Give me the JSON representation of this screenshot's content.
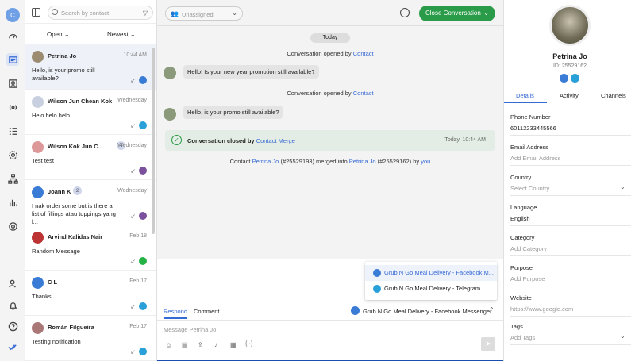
{
  "rail": {
    "avatar_initial": "C",
    "icons": [
      "dashboard-icon",
      "inbox-icon",
      "contacts-icon",
      "broadcast-icon",
      "checklist-icon",
      "settings-cog-icon",
      "workflow-icon",
      "reports-icon",
      "settings-icon",
      "add-user-icon",
      "bell-icon",
      "help-icon",
      "checkmarks-icon"
    ]
  },
  "list": {
    "search_placeholder": "Search by contact",
    "filter_open": "Open",
    "filter_sort": "Newest",
    "items": [
      {
        "name": "Petrina Jo",
        "time": "10:44 AM",
        "preview": "Hello, is your promo still available?",
        "channel": "messenger",
        "badge": "",
        "avcolor": "#9b8b70"
      },
      {
        "name": "Wilson Jun Chean Kok",
        "time": "Wednesday",
        "preview": "Helo helo helo",
        "channel": "telegram",
        "badge": "",
        "avcolor": "#c8d0e0"
      },
      {
        "name": "Wilson Kok Jun C...",
        "time": "Wednesday",
        "preview": "Test test",
        "channel": "viber",
        "badge": "4",
        "avcolor": "#d99"
      },
      {
        "name": "Joann K",
        "time": "Wednesday",
        "preview": "I nak order some but is there a list of fillings atau toppings yang l...",
        "channel": "viber",
        "badge": "2",
        "avcolor": "#3a7bd5"
      },
      {
        "name": "Arvind Kalidas Nair",
        "time": "Feb 18",
        "preview": "Random Message",
        "channel": "whatsapp",
        "badge": "",
        "avcolor": "#b33"
      },
      {
        "name": "C L",
        "time": "Feb 17",
        "preview": "Thanks",
        "channel": "telegram",
        "badge": "",
        "avcolor": "#3a7bd5"
      },
      {
        "name": "Román Filgueira",
        "time": "Feb 17",
        "preview": "Testing notification",
        "channel": "telegram",
        "badge": "",
        "avcolor": "#a77"
      }
    ]
  },
  "center": {
    "assign_label": "Unassigned",
    "close_label": "Close Conversation",
    "day": "Today",
    "sys1_pre": "Conversation opened by ",
    "sys1_link": "Contact",
    "msg1": "Hello! Is your new year promotion still available?",
    "sys2_pre": "Conversation opened by ",
    "sys2_link": "Contact",
    "msg2": "Hello, is your promo still available?",
    "closed_pre": "Conversation closed by ",
    "closed_link": "Contact Merge",
    "closed_time": "Today, 10:44 AM",
    "merge": {
      "a": "Contact ",
      "b": "Petrina Jo",
      "c": " (#25529193) merged into ",
      "d": "Petrina Jo",
      "e": " (#25529162) by ",
      "f": "you"
    },
    "menu": [
      "Grub N Go Meal Delivery - Facebook M...",
      "Grub N Go Meal Delivery - Telegram"
    ],
    "tab_respond": "Respond",
    "tab_comment": "Comment",
    "channel_selected": "Grub N Go Meal Delivery - Facebook Messenger",
    "composer_placeholder": "Message Petrina Jo",
    "accent": "#2a9b48"
  },
  "contact": {
    "name": "Petrina Jo",
    "id": "ID: 25529162",
    "tabs": [
      "Details",
      "Activity",
      "Channels"
    ],
    "fields": [
      {
        "label": "Phone Number",
        "value": "60112233445566",
        "placeholder": false
      },
      {
        "label": "Email Address",
        "value": "Add Email Address",
        "placeholder": true
      },
      {
        "label": "Country",
        "value": "Select Country",
        "placeholder": true
      },
      {
        "label": "Language",
        "value": "English",
        "placeholder": false
      },
      {
        "label": "Category",
        "value": "Add Category",
        "placeholder": true
      },
      {
        "label": "Purpose",
        "value": "Add Purpose",
        "placeholder": true
      },
      {
        "label": "Website",
        "value": "https://www.google.com",
        "placeholder": true
      },
      {
        "label": "Tags",
        "value": "Add Tags",
        "placeholder": true
      }
    ]
  }
}
